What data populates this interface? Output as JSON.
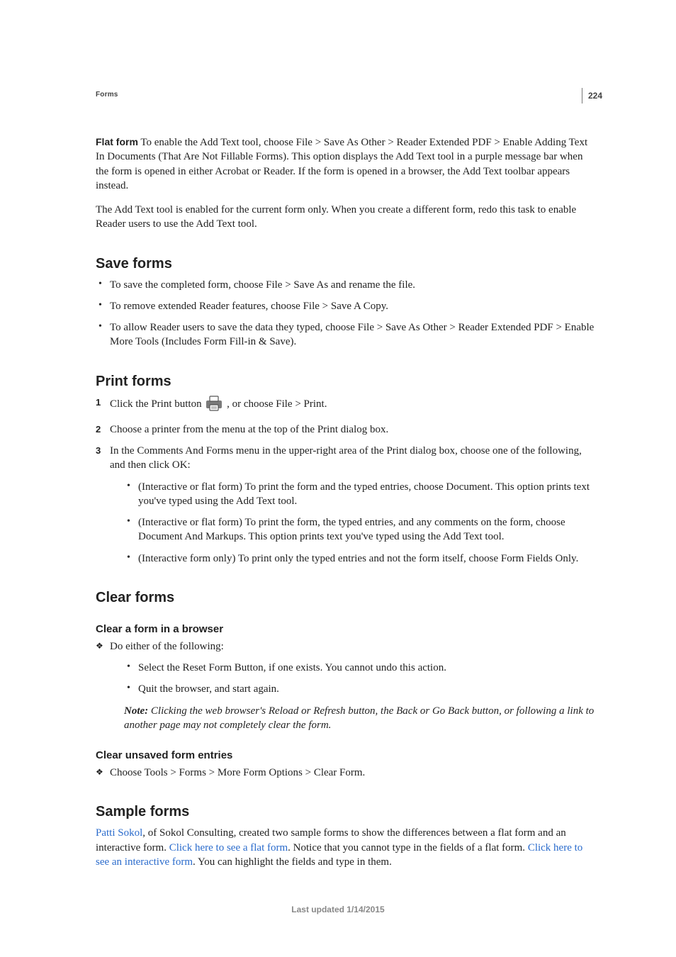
{
  "page_number": "224",
  "breadcrumb": "Forms",
  "flat_form": {
    "label": "Flat form",
    "text1": "To enable the Add Text tool, choose File > Save As Other > Reader Extended PDF > Enable Adding Text In Documents (That Are Not Fillable Forms). This option displays the Add Text tool in a purple message bar when the form is opened in either Acrobat or Reader. If the form is opened in a browser, the Add Text toolbar appears instead.",
    "text2": "The Add Text tool is enabled for the current form only. When you create a different form, redo this task to enable Reader users to use the Add Text tool."
  },
  "save_forms": {
    "heading": "Save forms",
    "items": [
      "To save the completed form, choose File > Save As and rename the file.",
      "To remove extended Reader features, choose File > Save A Copy.",
      "To allow Reader users to save the data they typed, choose File > Save As Other > Reader Extended PDF > Enable More Tools (Includes Form Fill-in & Save)."
    ]
  },
  "print_forms": {
    "heading": "Print forms",
    "step1_a": "Click the Print button ",
    "step1_b": ", or choose File > Print.",
    "step2": "Choose a printer from the menu at the top of the Print dialog box.",
    "step3": "In the Comments And Forms menu in the upper-right area of the Print dialog box, choose one of the following, and then click OK:",
    "sub": [
      "(Interactive or flat form) To print the form and the typed entries, choose Document. This option prints text you've typed using the Add Text tool.",
      "(Interactive or flat form) To print the form, the typed entries, and any comments on the form, choose Document And Markups. This option prints text you've typed using the Add Text tool.",
      "(Interactive form only) To print only the typed entries and not the form itself, choose Form Fields Only."
    ]
  },
  "clear_forms": {
    "heading": "Clear forms",
    "browser": {
      "heading": "Clear a form in a browser",
      "lead": "Do either of the following:",
      "items": [
        "Select the Reset Form Button, if one exists. You cannot undo this action.",
        "Quit the browser, and start again."
      ],
      "note_label": "Note:",
      "note_text": " Clicking the web browser's Reload or Refresh button, the Back or Go Back button, or following a link to another page may not completely clear the form."
    },
    "unsaved": {
      "heading": "Clear unsaved form entries",
      "text": "Choose Tools > Forms > More Form Options > Clear Form."
    }
  },
  "sample_forms": {
    "heading": "Sample forms",
    "link1": "Patti Sokol",
    "t1": ", of Sokol Consulting, created two sample forms to show the differences between a flat form and an interactive form. ",
    "link2": "Click here to see a flat form",
    "t2": ". Notice that you cannot type in the fields of a flat form. ",
    "link3": "Click here to see an interactive form",
    "t3": ". You can highlight the fields and type in them."
  },
  "footer": "Last updated 1/14/2015"
}
